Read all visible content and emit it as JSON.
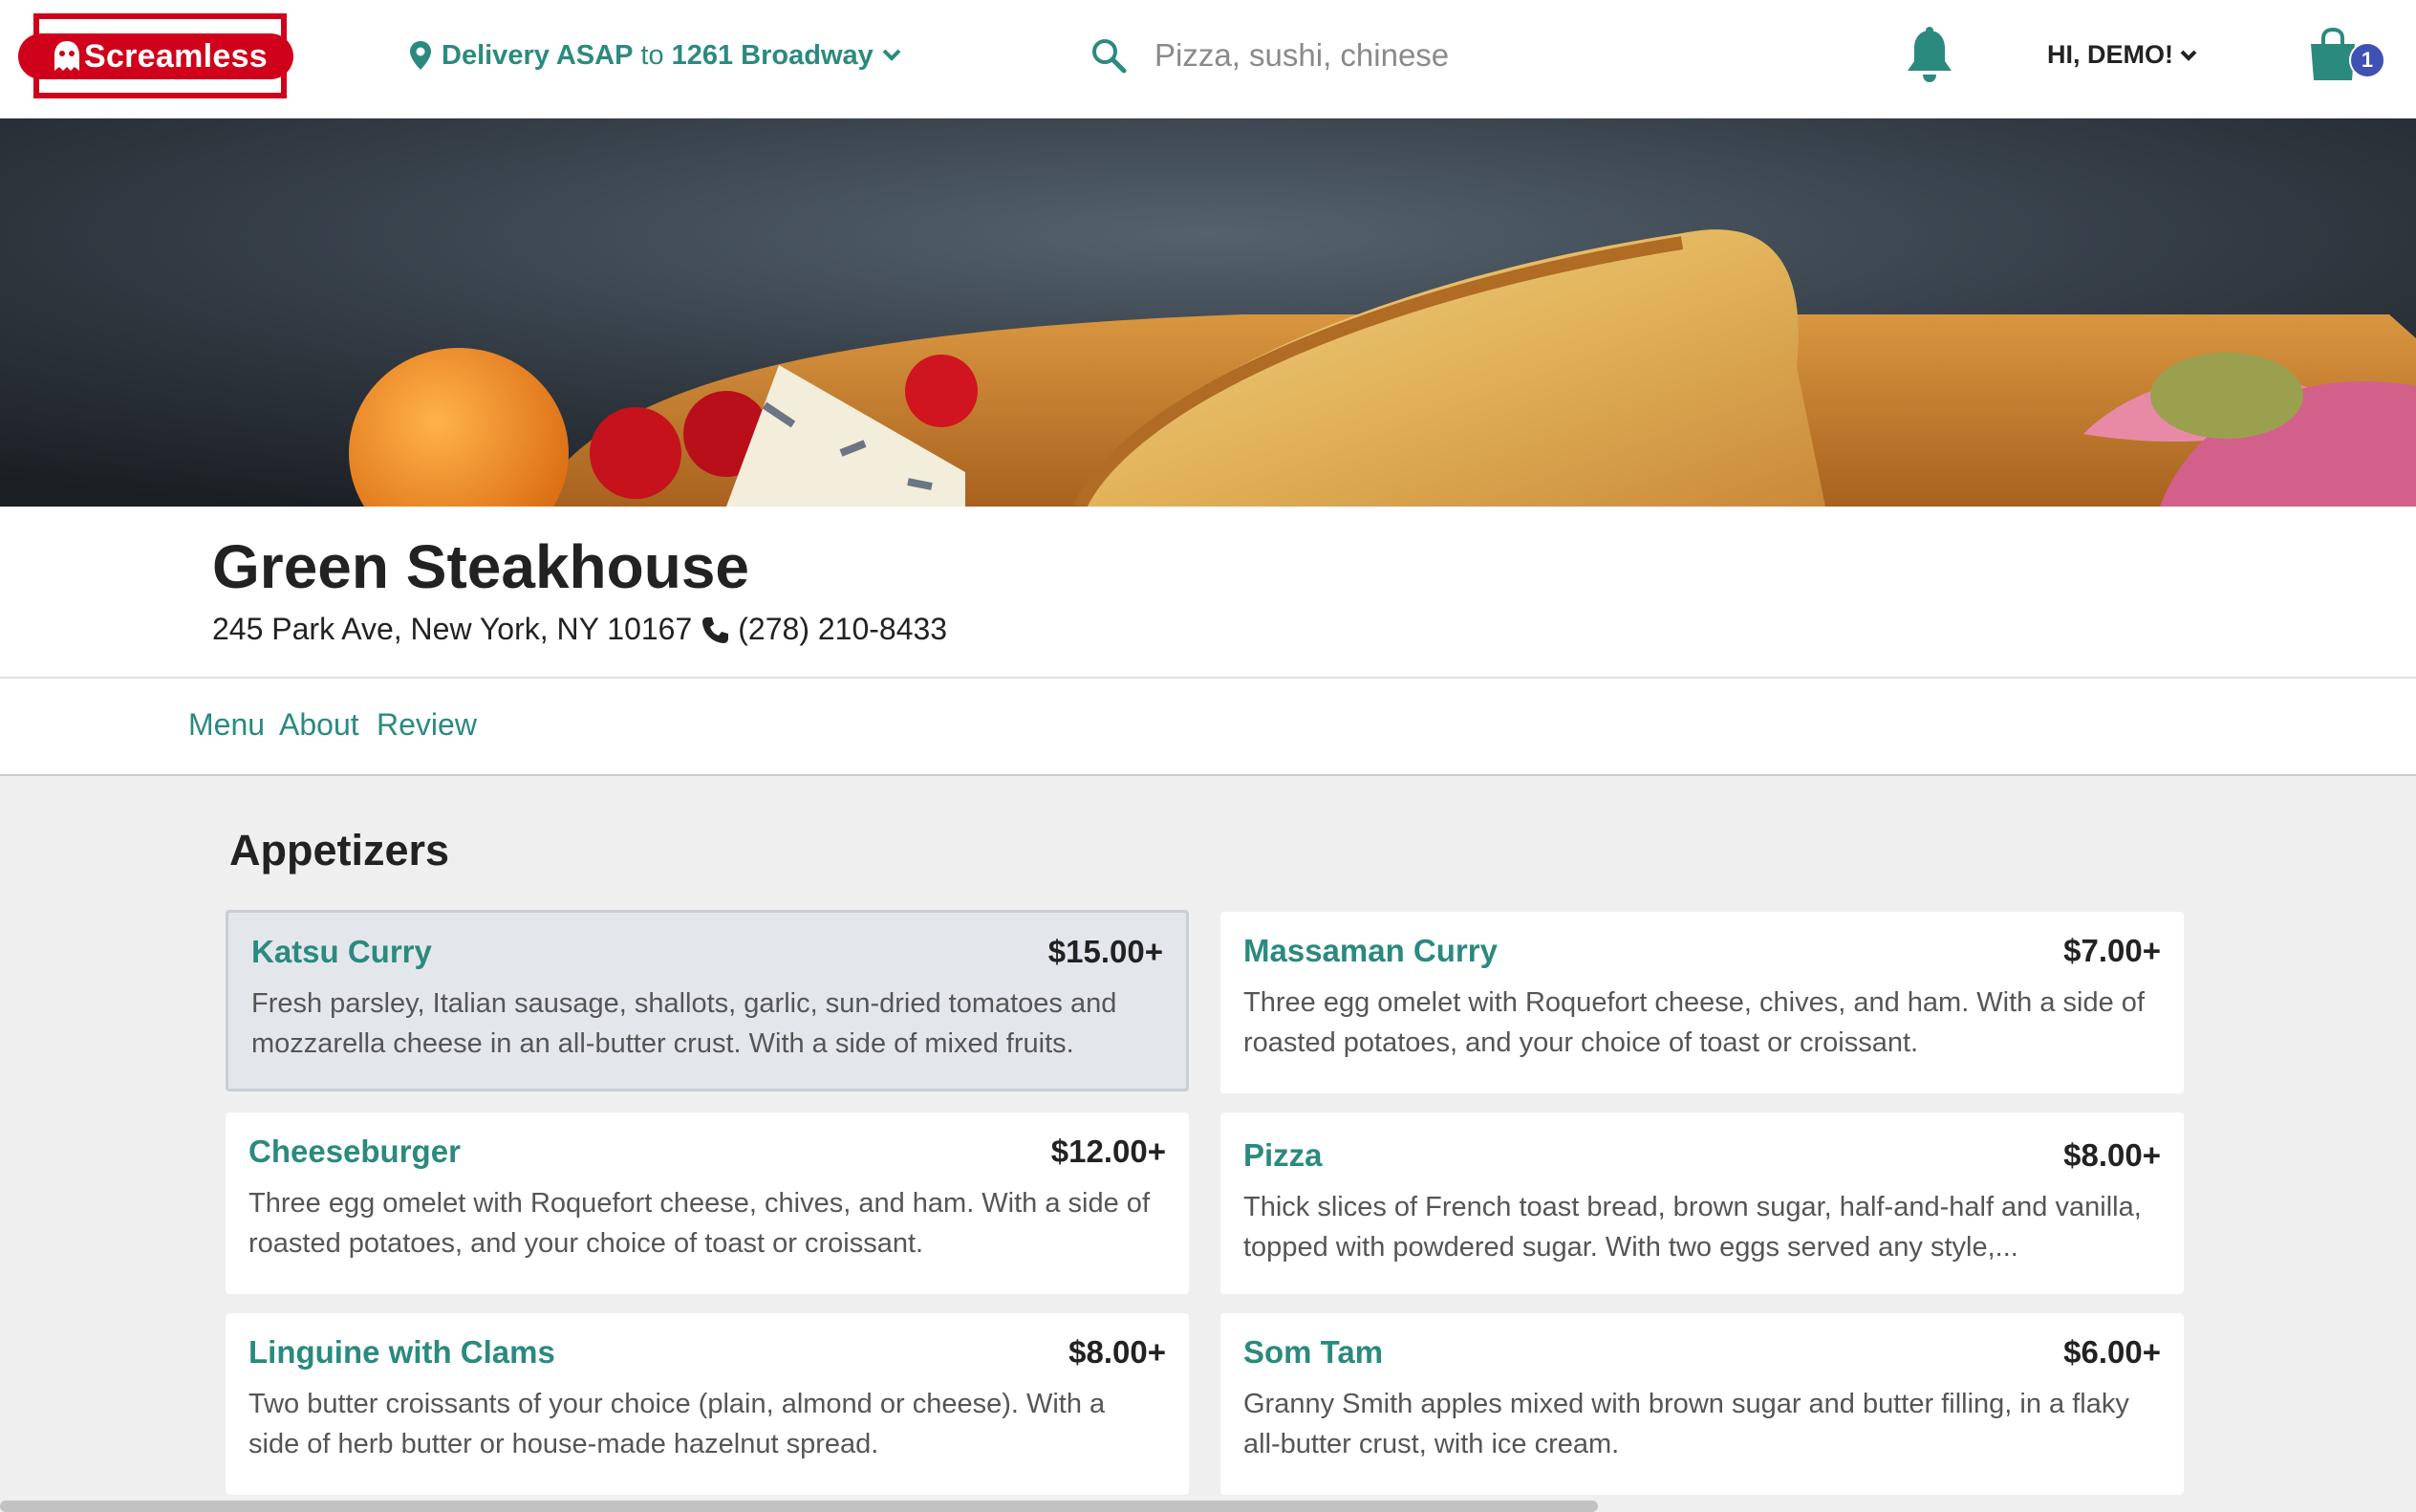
{
  "header": {
    "logo_text": "Screamless",
    "delivery_prefix": "Delivery ASAP",
    "delivery_to": "to",
    "delivery_address": "1261 Broadway",
    "search_placeholder": "Pizza, sushi, chinese",
    "user_greeting": "HI, DEMO!",
    "cart_count": "1"
  },
  "restaurant": {
    "name": "Green Steakhouse",
    "address": "245 Park Ave, New York, NY 10167",
    "phone": "(278) 210-8433"
  },
  "tabs": [
    "Menu",
    "About",
    "Review"
  ],
  "menu": {
    "section_title": "Appetizers",
    "items": [
      {
        "name": "Katsu Curry",
        "price": "$15.00+",
        "desc": "Fresh parsley, Italian sausage, shallots, garlic, sun-dried tomatoes and mozzarella cheese in an all-butter crust. With a side of mixed fruits."
      },
      {
        "name": "Massaman Curry",
        "price": "$7.00+",
        "desc": "Three egg omelet with Roquefort cheese, chives, and ham. With a side of roasted potatoes, and your choice of toast or croissant."
      },
      {
        "name": "Cheeseburger",
        "price": "$12.00+",
        "desc": "Three egg omelet with Roquefort cheese, chives, and ham. With a side of roasted potatoes, and your choice of toast or croissant."
      },
      {
        "name": "Pizza",
        "price": "$8.00+",
        "desc": "Thick slices of French toast bread, brown sugar, half-and-half and vanilla, topped with powdered sugar. With two eggs served any style,..."
      },
      {
        "name": "Linguine with Clams",
        "price": "$8.00+",
        "desc": "Two butter croissants of your choice (plain, almond or cheese). With a side of herb butter or house-made hazelnut spread."
      },
      {
        "name": "Som Tam",
        "price": "$6.00+",
        "desc": "Granny Smith apples mixed with brown sugar and butter filling, in a flaky all-butter crust, with ice cream."
      }
    ]
  },
  "colors": {
    "brand_red": "#d0021b",
    "accent_teal": "#2b8a7e",
    "badge_blue": "#3f51b5"
  },
  "icons": [
    "map-pin-icon",
    "chevron-down-icon",
    "search-icon",
    "bell-icon",
    "shopping-bag-icon",
    "phone-icon",
    "ghost-logo-icon"
  ]
}
